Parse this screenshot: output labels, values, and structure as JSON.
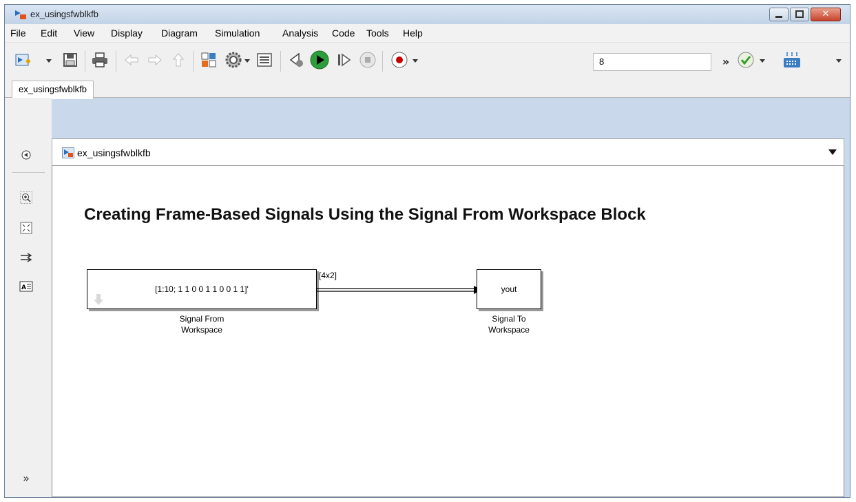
{
  "window": {
    "title": "ex_usingsfwblkfb"
  },
  "menu": {
    "items": [
      "File",
      "Edit",
      "View",
      "Display",
      "Diagram",
      "Simulation",
      "Analysis",
      "Code",
      "Tools",
      "Help"
    ]
  },
  "toolbar": {
    "stop_time": "8",
    "more": "»"
  },
  "tabs": [
    {
      "label": "ex_usingsfwblkfb"
    }
  ],
  "address": {
    "path": "ex_usingsfwblkfb"
  },
  "diagram": {
    "annotation": "Creating Frame-Based Signals Using the Signal From Workspace Block",
    "source_block": {
      "value": "[1:10; 1 1 0 0 1 1 0 0 1 1]'",
      "label_line1": "Signal From",
      "label_line2": "Workspace"
    },
    "signal": {
      "dimension": "[4x2]"
    },
    "sink_block": {
      "value": "yout",
      "label_line1": "Signal To",
      "label_line2": "Workspace"
    }
  },
  "icons": [
    "model-icon",
    "save-icon",
    "print-icon",
    "back-icon",
    "forward-icon",
    "up-icon",
    "library-browser-icon",
    "settings-icon",
    "model-explorer-icon",
    "step-back-icon",
    "run-icon",
    "step-forward-icon",
    "stop-icon",
    "record-icon",
    "check-icon",
    "build-icon",
    "hide-browser-icon",
    "zoom-icon",
    "fit-to-view-icon",
    "arrow-icon",
    "annotation-icon",
    "expand-icon"
  ],
  "colors": {
    "run": "#2e9e3a",
    "record": "#c40000",
    "close": "#c8432b"
  }
}
